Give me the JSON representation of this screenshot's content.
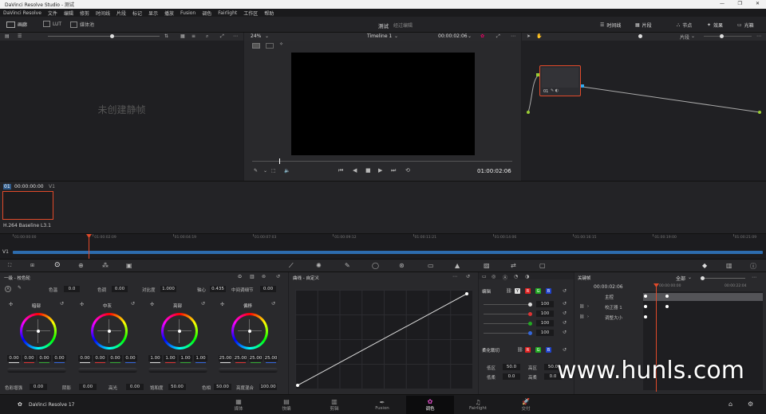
{
  "window": {
    "title": "DaVinci Resolve Studio - 测试"
  },
  "menu": [
    "DaVinci Resolve",
    "文件",
    "编辑",
    "修剪",
    "时间线",
    "片段",
    "标记",
    "显示",
    "播放",
    "Fusion",
    "调色",
    "Fairlight",
    "工作区",
    "帮助"
  ],
  "header": {
    "gallery": "画廊",
    "lut": "LUT",
    "media_pool": "媒体池",
    "project_name": "测试",
    "project_status": "经过编辑",
    "timeline": "时间线",
    "clips": "片段",
    "nodes": "节点",
    "effects": "效果",
    "lightbox": "光箱"
  },
  "viewer": {
    "zoom": "24%",
    "timeline_name": "Timeline 1",
    "timecode_top": "00:00:02:06",
    "timecode_bottom": "01:00:02:06",
    "no_stills": "未创建静帧"
  },
  "node_panel": {
    "clip_dropdown": "片段",
    "node_label": "01"
  },
  "clip_strip": {
    "clip_num": "01",
    "clip_tc": "00:00:00:00",
    "track": "V1",
    "codec": "H.264 Baseline L3.1"
  },
  "ruler": {
    "track": "V1",
    "ticks": [
      "01:00:00:00",
      "01:00:02:09",
      "01:00:04:19",
      "01:00:07:03",
      "01:00:09:12",
      "01:00:11:21",
      "01:00:14:06",
      "01:00:16:15",
      "01:00:19:00",
      "01:00:21:09"
    ]
  },
  "primaries": {
    "title": "一级 - 校色轮",
    "contrast_row": [
      {
        "label": "色温",
        "value": "0.0"
      },
      {
        "label": "色调",
        "value": "0.00"
      },
      {
        "label": "对比度",
        "value": "1.000"
      },
      {
        "label": "轴心",
        "value": "0.435"
      },
      {
        "label": "中间调细节",
        "value": "0.00"
      }
    ],
    "wheels": [
      {
        "name": "暗部",
        "values": [
          "0.00",
          "0.00",
          "0.00",
          "0.00"
        ]
      },
      {
        "name": "中灰",
        "values": [
          "0.00",
          "0.00",
          "0.00",
          "0.00"
        ]
      },
      {
        "name": "亮部",
        "values": [
          "1.00",
          "1.00",
          "1.00",
          "1.00"
        ]
      },
      {
        "name": "偏移",
        "values": [
          "25.00",
          "25.00",
          "25.00",
          "25.00"
        ]
      }
    ],
    "bottom_row": [
      {
        "label": "色彩增强",
        "value": "0.00"
      },
      {
        "label": "阴影",
        "value": "0.00"
      },
      {
        "label": "高光",
        "value": "0.00"
      },
      {
        "label": "饱和度",
        "value": "50.00"
      },
      {
        "label": "色相",
        "value": "50.00"
      },
      {
        "label": "亮度混合",
        "value": "100.00"
      }
    ]
  },
  "curves": {
    "title": "曲线 - 自定义"
  },
  "edit": {
    "title": "编辑",
    "channels": [
      "Y",
      "R",
      "G",
      "B"
    ],
    "values": [
      "100",
      "100",
      "100",
      "100"
    ],
    "soft_clip": "柔化裁切",
    "low": "低区",
    "low_val": "50.0",
    "high": "高区",
    "high_val": "50.0",
    "low_soft": "低柔",
    "low_soft_val": "0.0",
    "high_soft": "高柔",
    "high_soft_val": "0.0"
  },
  "keyframes": {
    "title": "关键帧",
    "filter": "全部",
    "timecode": "00:00:02:06",
    "tc_left": "00:00:00:00",
    "tc_right": "00:00:22:04",
    "tracks": [
      "主控",
      "校正器 1",
      "调整大小"
    ]
  },
  "bottom_bar": {
    "app": "DaVinci Resolve 17",
    "pages": [
      "媒体",
      "快编",
      "剪辑",
      "Fusion",
      "调色",
      "Fairlight",
      "交付"
    ]
  },
  "watermark": "www.hunls.com"
}
